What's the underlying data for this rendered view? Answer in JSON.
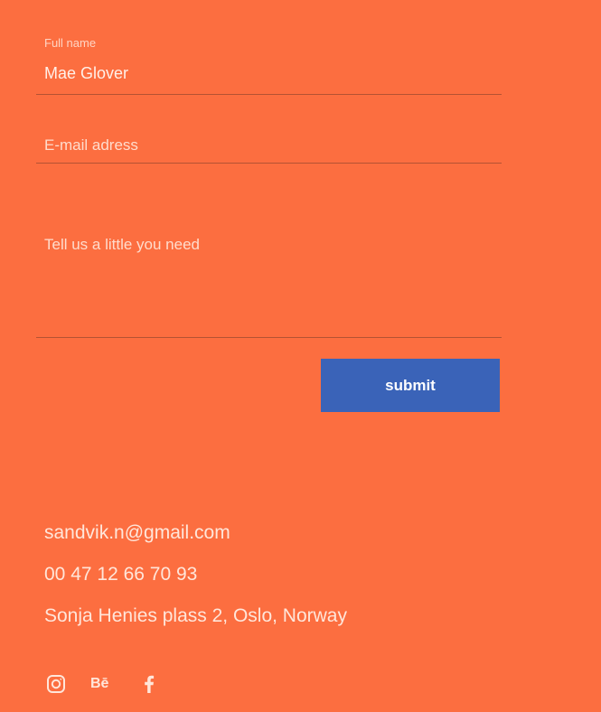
{
  "form": {
    "full_name": {
      "label": "Full name",
      "value": "Mae Glover"
    },
    "email": {
      "placeholder": "E-mail adress",
      "value": ""
    },
    "message": {
      "placeholder": "Tell us a little you need",
      "value": ""
    },
    "submit_label": "submit"
  },
  "contact": {
    "email": "sandvik.n@gmail.com",
    "phone": "00 47 12 66 70 93",
    "address": "Sonja Henies plass 2, Oslo, Norway"
  },
  "social": {
    "instagram_icon": "instagram-icon",
    "behance_text": "Bē",
    "behance_icon": "behance-icon",
    "facebook_icon": "facebook-icon"
  },
  "colors": {
    "background": "#FC6E40",
    "button": "#3A63B8",
    "text": "#FFE6DA"
  }
}
